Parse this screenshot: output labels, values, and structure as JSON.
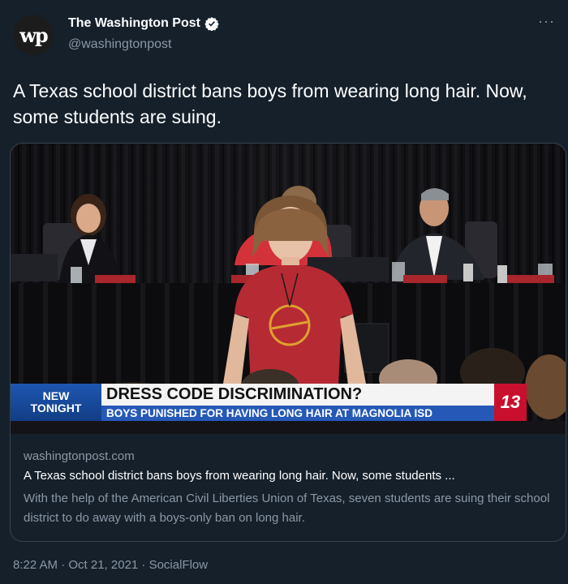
{
  "author": {
    "display_name": "The Washington Post",
    "handle": "@washingtonpost",
    "avatar_text": "wp"
  },
  "tweet": {
    "text": "A Texas school district bans boys from wearing long hair. Now, some students are suing."
  },
  "card": {
    "image": {
      "lower_third": {
        "tag_line1": "NEW",
        "tag_line2": "TONIGHT",
        "headline": "DRESS CODE DISCRIMINATION?",
        "subline": "BOYS PUNISHED FOR HAVING LONG HAIR AT MAGNOLIA ISD",
        "station_logo": "13"
      }
    },
    "domain": "washingtonpost.com",
    "title": "A Texas school district bans boys from wearing long hair. Now, some students ...",
    "description": "With the help of the American Civil Liberties Union of Texas, seven students are suing their school district to do away with a boys-only ban on long hair."
  },
  "meta": {
    "timestamp": "8:22 AM · Oct 21, 2021 · SocialFlow"
  },
  "icons": {
    "more": "more-options-icon",
    "verified": "verified-badge-icon"
  },
  "colors": {
    "background": "#15202b",
    "text_secondary": "#8b98a5",
    "verified": "#ffffff"
  }
}
